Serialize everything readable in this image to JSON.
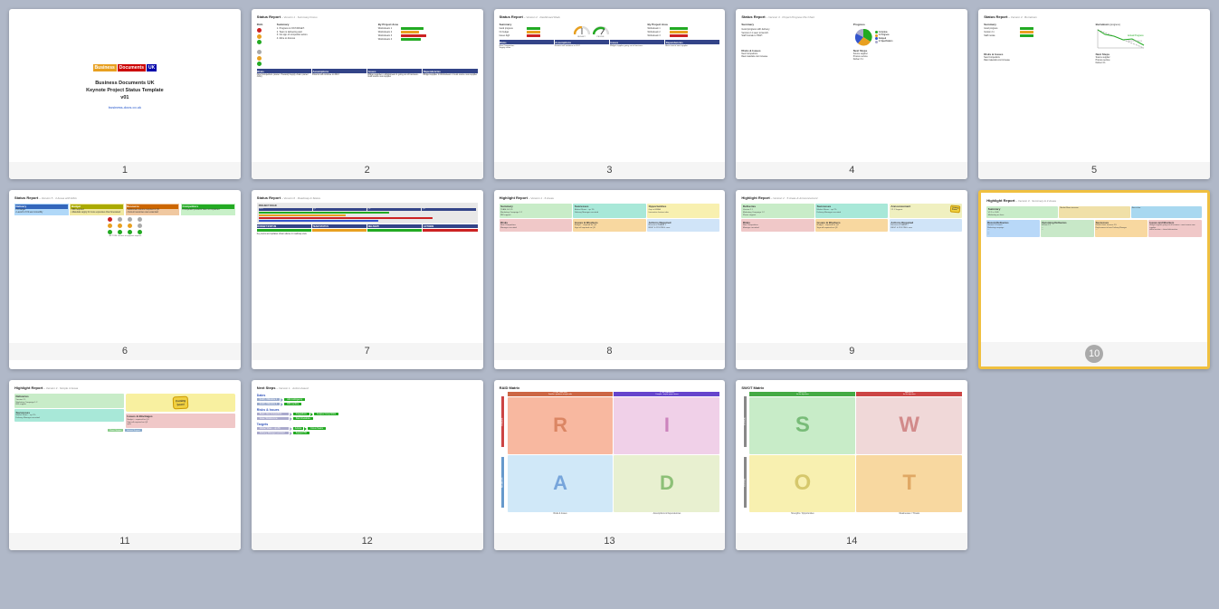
{
  "slides": [
    {
      "id": 1,
      "number": "1",
      "type": "cover",
      "title": "Business Documents UK\nKeynote Project Status Template\nv01",
      "link": "business-docs.co.uk",
      "highlighted": false
    },
    {
      "id": 2,
      "number": "2",
      "type": "status-report-1",
      "title": "Status Report",
      "version": "– Version 1 · Summary Focus",
      "highlighted": false
    },
    {
      "id": 3,
      "number": "3",
      "type": "status-report-2",
      "title": "Status Report",
      "version": "– Version 2 · Dashboard Dials",
      "highlighted": false
    },
    {
      "id": 4,
      "number": "4",
      "type": "status-report-3",
      "title": "Status Report",
      "version": "– Version 3 · Project Progress Pie Chart",
      "highlighted": false
    },
    {
      "id": 5,
      "number": "5",
      "type": "status-report-4",
      "title": "Status Report",
      "version": "– Version 4 · Burndown",
      "highlighted": false
    },
    {
      "id": 6,
      "number": "6",
      "type": "status-report-5",
      "title": "Status Report",
      "version": "– Version 5 · 4 Areas with RAG",
      "highlighted": false
    },
    {
      "id": 7,
      "number": "7",
      "type": "status-report-6",
      "title": "Status Report",
      "version": "– Version 6 · Roadmap & Status",
      "highlighted": false
    },
    {
      "id": 8,
      "number": "8",
      "type": "highlight-report-1",
      "title": "Highlight Report",
      "version": "– Version 1 · 6 Areas",
      "highlighted": false
    },
    {
      "id": 9,
      "number": "9",
      "type": "highlight-report-2",
      "title": "Highlight Report",
      "version": "– Version 2 · 5 Areas & Announcement",
      "highlighted": false
    },
    {
      "id": 10,
      "number": "10",
      "type": "highlight-report-3",
      "title": "Highlight Report",
      "version": "– Version 3 · Summary & 4 Areas",
      "highlighted": true
    },
    {
      "id": 11,
      "number": "11",
      "type": "highlight-report-4",
      "title": "Highlight Report",
      "version": "– Version 4 · Simple 4 Areas",
      "highlighted": false
    },
    {
      "id": 12,
      "number": "12",
      "type": "next-steps",
      "title": "Next Steps",
      "version": "– Version 1 · Action-based",
      "highlighted": false
    },
    {
      "id": 13,
      "number": "13",
      "type": "raid-matrix",
      "title": "RAID Matrix",
      "version": "",
      "highlighted": false
    },
    {
      "id": 14,
      "number": "14",
      "type": "swot-matrix",
      "title": "SWOT Matrix",
      "version": "",
      "highlighted": false
    }
  ]
}
